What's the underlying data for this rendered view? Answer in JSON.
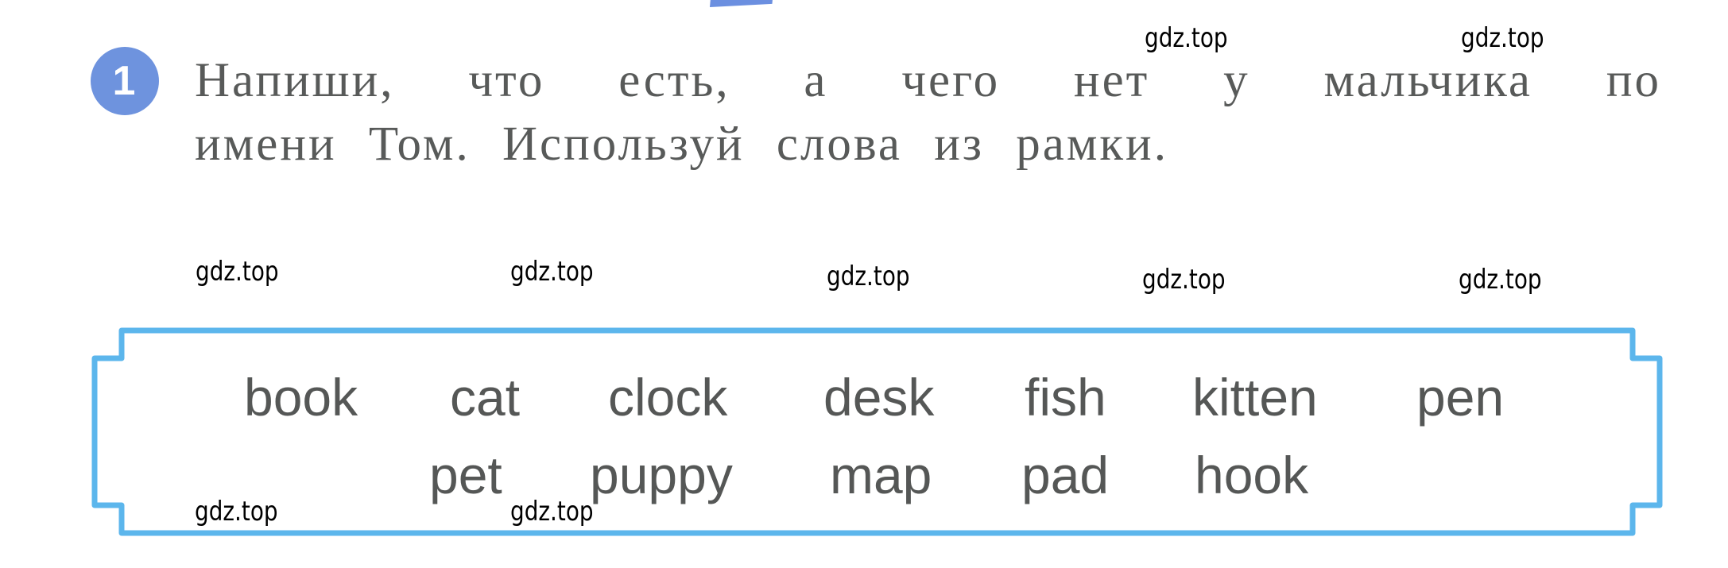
{
  "page": {
    "top_tab_color": "#6b8fe0",
    "exercise": {
      "number": "1",
      "badge_color": "#6e93de",
      "instruction_line1": "Напиши, что есть, а чего нет у мальчика по",
      "instruction_line2": "имени Том. Используй слова из рамки."
    },
    "word_box": {
      "border_color": "#5cb6ec",
      "row1": [
        "book",
        "cat",
        "clock",
        "desk",
        "fish",
        "kitten",
        "pen"
      ],
      "row2": [
        "pet",
        "puppy",
        "map",
        "pad",
        "hook"
      ]
    },
    "watermarks": [
      "gdz.top",
      "gdz.top",
      "gdz.top",
      "gdz.top",
      "gdz.top",
      "gdz.top",
      "gdz.top",
      "gdz.top",
      "gdz.top"
    ]
  }
}
